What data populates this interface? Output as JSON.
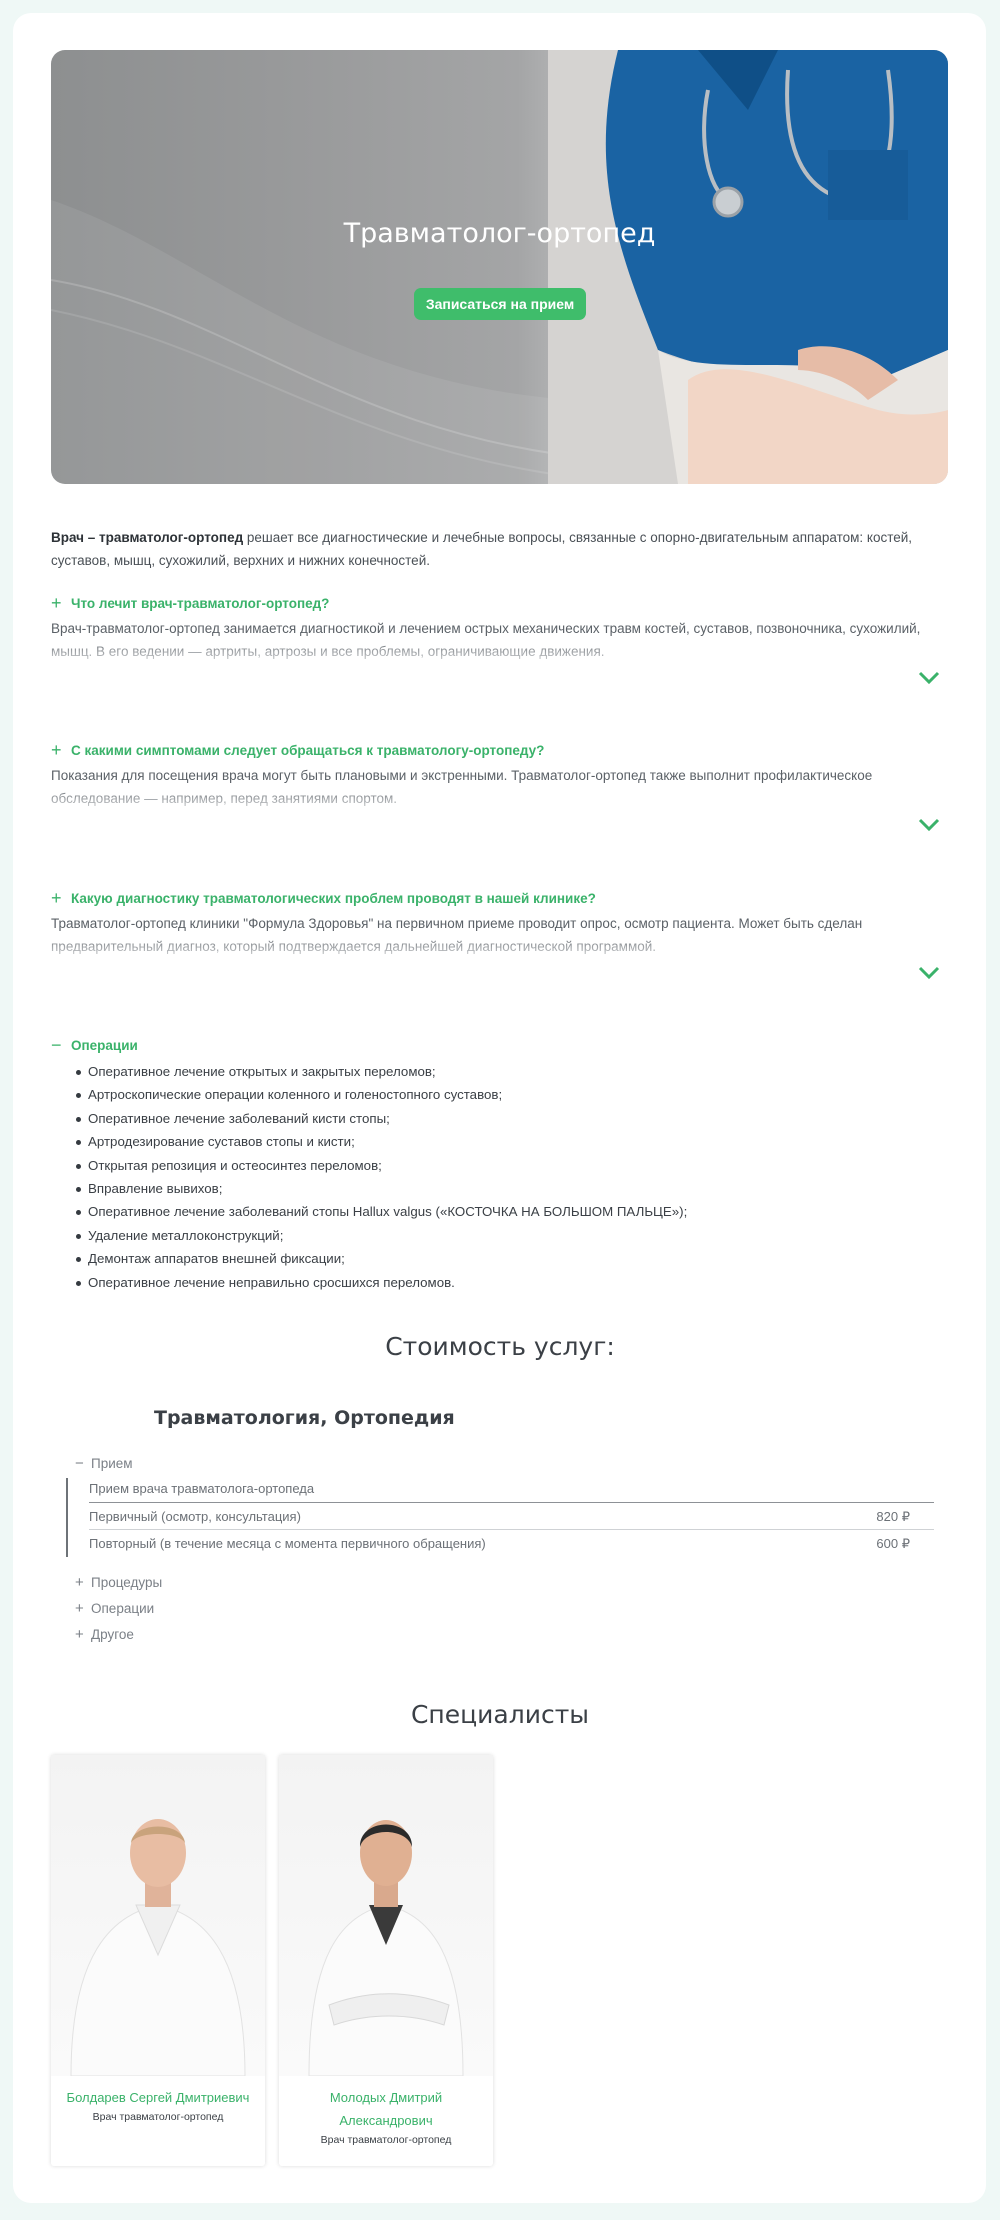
{
  "hero": {
    "title": "Травматолог-ортопед",
    "button": "Записаться на прием"
  },
  "intro": {
    "bold": "Врач – травматолог-ортопед",
    "text": " решает все диагностические и лечебные вопросы, связанные с опорно-двигательным аппаратом: костей, суставов, мышц, сухожилий, верхних и нижних конечностей."
  },
  "faq": [
    {
      "question": "Что лечит врач-травматолог-ортопед?",
      "answer": "Врач-травматолог-ортопед занимается диагностикой и лечением острых механических травм костей, суставов, позвоночника, сухожилий, мышц. В его ведении — артриты, артрозы и все проблемы, ограничивающие движения."
    },
    {
      "question": "С какими симптомами следует обращаться к травматологу-ортопеду?",
      "answer": "Показания для посещения врача могут быть плановыми и экстренными. Травматолог-ортопед также выполнит профилактическое обследование — например, перед занятиями спортом."
    },
    {
      "question": "Какую диагностику травматологических проблем проводят в нашей клинике?",
      "answer": "Травматолог-ортопед клиники \"Формула Здоровья\" на первичном приеме проводит опрос, осмотр пациента. Может быть сделан предварительный диагноз, который подтверждается дальнейшей диагностической программой."
    }
  ],
  "operations": {
    "title": "Операции",
    "items": [
      "Оперативное лечение открытых и закрытых переломов;",
      "Артроскопические операции коленного и голеностопного суставов;",
      "Оперативное лечение заболеваний кисти стопы;",
      "Артродезирование суставов стопы и кисти;",
      "Открытая репозиция и остеосинтез переломов;",
      "Вправление вывихов;",
      "Оперативное лечение заболеваний стопы Hallux valgus («КОСТОЧКА НА БОЛЬШОМ ПАЛЬЦЕ»);",
      "Удаление металлоконструкций;",
      "Демонтаж аппаратов внешней фиксации;",
      "Оперативное лечение неправильно сросшихся переломов."
    ]
  },
  "prices": {
    "heading": "Стоимость услуг:",
    "section": "Травматология, Ортопедия",
    "open_category": "Прием",
    "table_title": "Прием врача травматолога-ортопеда",
    "rows": [
      {
        "name": "Первичный (осмотр, консультация)",
        "price": "820 ₽"
      },
      {
        "name": "Повторный (в течение месяца с момента первичного обращения)",
        "price": "600 ₽"
      }
    ],
    "collapsed": [
      "Процедуры",
      "Операции",
      "Другое"
    ]
  },
  "specialists": {
    "heading": "Специалисты",
    "cards": [
      {
        "name": "Болдарев Сергей Дмитриевич",
        "role": "Врач травматолог-ортопед"
      },
      {
        "name": "Молодых Дмитрий Александрович",
        "role": "Врач травматолог-ортопед"
      }
    ]
  },
  "colors": {
    "accent": "#3fbd6b",
    "background": "#eff8f6",
    "text": "#343a40"
  }
}
